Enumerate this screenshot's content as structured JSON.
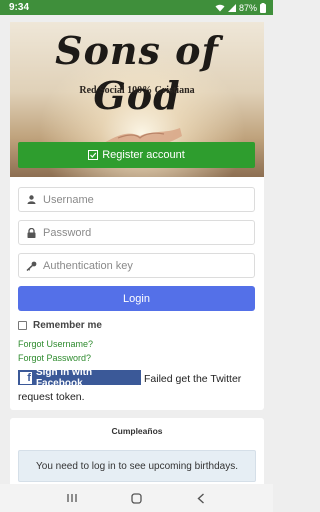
{
  "status_bar": {
    "time": "9:34",
    "battery": "87%"
  },
  "banner": {
    "title": "Sons of God",
    "subtitle": "Red Social 100% Cristiana"
  },
  "register_button": {
    "label": "Register account"
  },
  "login_form": {
    "username_placeholder": "Username",
    "password_placeholder": "Password",
    "auth_key_placeholder": "Authentication key",
    "login_label": "Login",
    "remember_label": "Remember me",
    "forgot_username": "Forgot Username?",
    "forgot_password": "Forgot Password?"
  },
  "social": {
    "facebook_label": "Sign in with Facebook",
    "twitter_error": "Failed get the Twitter request token."
  },
  "birthdays": {
    "title": "Cumpleaños",
    "message": "You need to log in to see upcoming birthdays."
  },
  "colors": {
    "status_bar": "#3f8f3b",
    "register_green": "#2e9d2e",
    "login_blue": "#5470e8",
    "facebook_blue": "#3b5998",
    "link_green": "#2e8b2e"
  },
  "icons": [
    "wifi-icon",
    "signal-icon",
    "battery-icon",
    "check-icon",
    "user-icon",
    "lock-icon",
    "key-icon",
    "facebook-icon",
    "recent-apps-icon",
    "home-icon",
    "back-icon"
  ]
}
